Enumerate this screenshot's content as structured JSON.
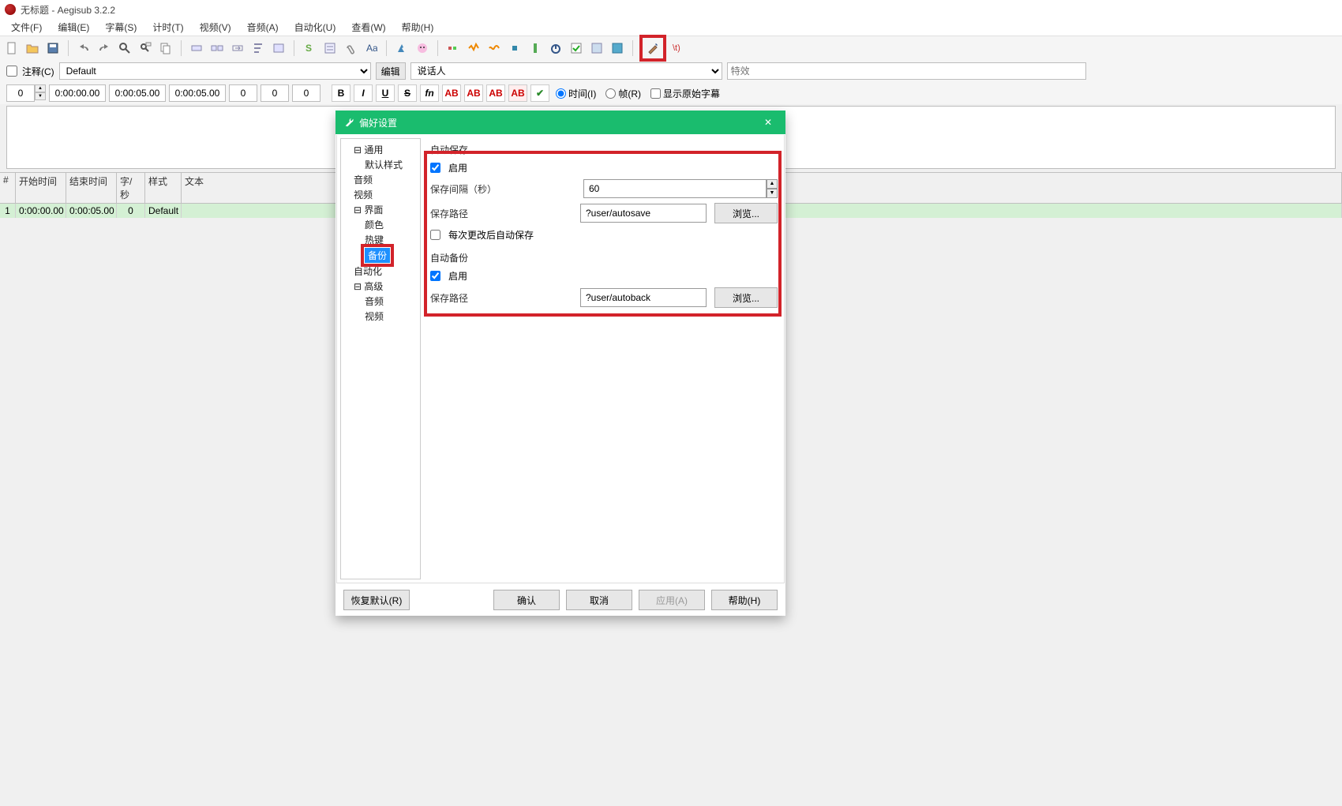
{
  "window": {
    "title": "无标题 - Aegisub 3.2.2"
  },
  "menu": {
    "file": "文件(F)",
    "edit": "编辑(E)",
    "subtitle": "字幕(S)",
    "timing": "计时(T)",
    "video": "视频(V)",
    "audio": "音频(A)",
    "automation": "自动化(U)",
    "view": "查看(W)",
    "help": "帮助(H)"
  },
  "edit": {
    "comment_label": "注释(C)",
    "style": "Default",
    "edit_btn": "编辑",
    "actor_placeholder": "说话人",
    "effect_placeholder": "特效",
    "layer": "0",
    "start": "0:00:00.00",
    "end": "0:00:05.00",
    "dur": "0:00:05.00",
    "margL": "0",
    "margR": "0",
    "margV": "0",
    "opt_time": "时间(I)",
    "opt_frame": "帧(R)",
    "show_original": "显示原始字幕"
  },
  "grid": {
    "headers": {
      "num": "#",
      "start": "开始时间",
      "end": "结束时间",
      "cps": "字/秒",
      "style": "样式",
      "text": "文本"
    },
    "row": {
      "num": "1",
      "start": "0:00:00.00",
      "end": "0:00:05.00",
      "cps": "0",
      "style": "Default",
      "text": ""
    }
  },
  "dialog": {
    "title": "偏好设置",
    "tree": {
      "general": "通用",
      "default_styles": "默认样式",
      "audio": "音频",
      "video": "视频",
      "interface": "界面",
      "colors": "颜色",
      "hotkeys": "热键",
      "backup": "备份",
      "automation": "自动化",
      "advanced": "高级",
      "adv_audio": "音频",
      "adv_video": "视频"
    },
    "content": {
      "sec_autosave": "自动保存",
      "enable1": "启用",
      "interval_label": "保存间隔（秒）",
      "interval_value": "60",
      "path_label": "保存路径",
      "path_value": "?user/autosave",
      "browse": "浏览...",
      "save_on_change": "每次更改后自动保存",
      "sec_autobackup": "自动备份",
      "enable2": "启用",
      "path2_label": "保存路径",
      "path2_value": "?user/autoback"
    },
    "footer": {
      "restore": "恢复默认(R)",
      "ok": "确认",
      "cancel": "取消",
      "apply": "应用(A)",
      "help": "帮助(H)"
    }
  }
}
